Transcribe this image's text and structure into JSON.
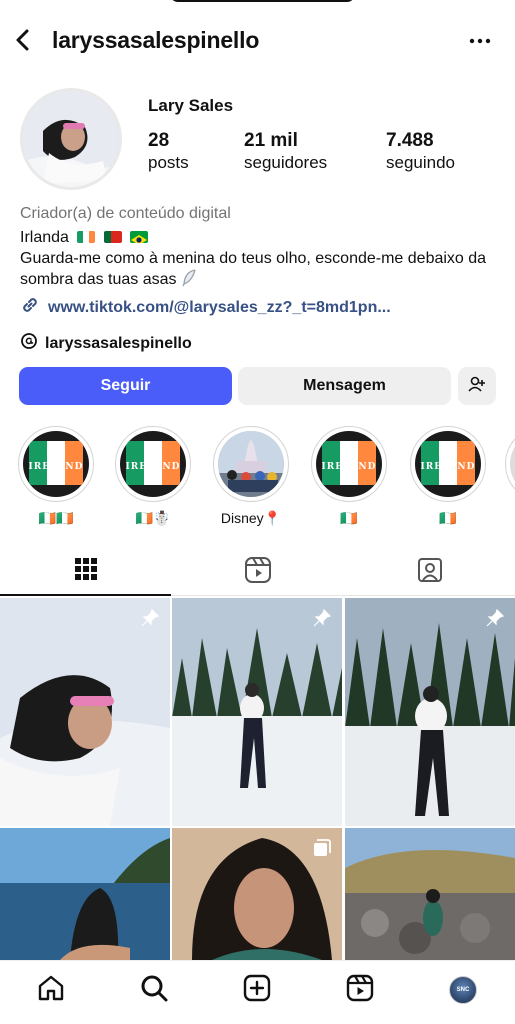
{
  "header": {
    "username": "laryssasalespinello",
    "back_icon": "chevron-left-icon",
    "more_icon": "more-horizontal-icon"
  },
  "profile": {
    "display_name": "Lary Sales",
    "stats": [
      {
        "value": "28",
        "label": "posts"
      },
      {
        "value": "21 mil",
        "label": "seguidores"
      },
      {
        "value": "7.488",
        "label": "seguindo"
      }
    ],
    "category": "Criador(a) de conteúdo digital",
    "bio_line1": "Irlanda",
    "bio_flags": [
      "ireland-flag",
      "portugal-flag",
      "brazil-flag"
    ],
    "bio_line2": "Guarda-me como à menina do teus olho, esconde-me debaixo da sombra das tuas asas",
    "bio_emoji": "feather-icon",
    "link": "www.tiktok.com/@larysales_zz?_t=8md1pn...",
    "threads_handle": "laryssasalespinello"
  },
  "actions": {
    "follow_label": "Seguir",
    "message_label": "Mensagem",
    "add_user_icon": "add-user-icon"
  },
  "highlights": [
    {
      "label": "🇮🇪🇮🇪",
      "cover_text": "IRELAND"
    },
    {
      "label": "🇮🇪☃️",
      "cover_text": "IRELAND"
    },
    {
      "label": "Disney📍",
      "cover_text": ""
    },
    {
      "label": "🇮🇪",
      "cover_text": "IRELAND"
    },
    {
      "label": "🇮🇪",
      "cover_text": "IRELAND"
    }
  ],
  "tabs": [
    {
      "name": "grid-icon",
      "active": true
    },
    {
      "name": "reels-icon",
      "active": false
    },
    {
      "name": "tagged-icon",
      "active": false
    }
  ],
  "posts": [
    {
      "pinned": true,
      "multi": false
    },
    {
      "pinned": true,
      "multi": false
    },
    {
      "pinned": true,
      "multi": false
    },
    {
      "pinned": false,
      "multi": false
    },
    {
      "pinned": false,
      "multi": true
    },
    {
      "pinned": false,
      "multi": false
    }
  ],
  "bottom_nav": [
    "home-icon",
    "search-icon",
    "create-icon",
    "reels-icon",
    "profile-avatar"
  ],
  "colors": {
    "accent": "#4a5df9",
    "link": "#385185",
    "secondary_text": "#737373"
  }
}
